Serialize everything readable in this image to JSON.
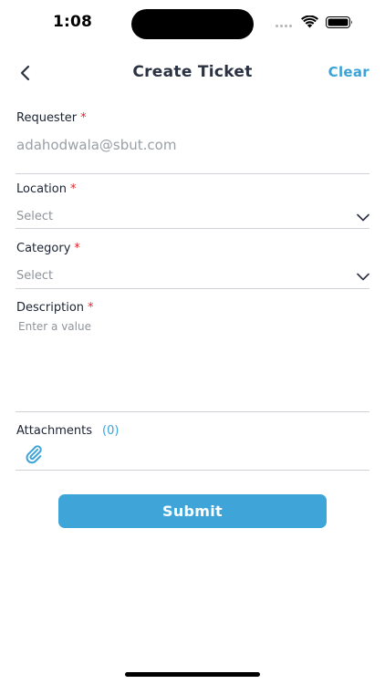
{
  "status_bar": {
    "time": "1:08",
    "icons": [
      "wifi-icon",
      "battery-icon"
    ]
  },
  "nav": {
    "back_icon": "chevron-left-icon",
    "title": "Create Ticket",
    "clear_label": "Clear"
  },
  "form": {
    "requester": {
      "label": "Requester",
      "required_marker": "*",
      "value": "adahodwala@sbut.com"
    },
    "location": {
      "label": "Location",
      "required_marker": "*",
      "value": "Select"
    },
    "category": {
      "label": "Category",
      "required_marker": "*",
      "value": "Select"
    },
    "description": {
      "label": "Description",
      "required_marker": "*",
      "placeholder": "Enter a value"
    },
    "attachments": {
      "label": "Attachments",
      "count": "(0)",
      "icon": "paperclip-icon"
    }
  },
  "submit_label": "Submit",
  "colors": {
    "accent": "#3fa4d8",
    "required": "#e0252b",
    "title": "#2b3242"
  }
}
